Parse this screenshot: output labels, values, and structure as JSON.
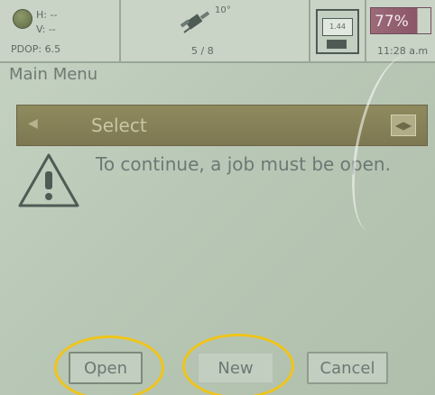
{
  "status": {
    "sat_h": "H: --",
    "sat_v": "V: --",
    "pdop": "PDOP: 6.5",
    "ant_degree": "10°",
    "ant_count": "5 / 8",
    "disk_label": "1.44",
    "battery_percent": "77%",
    "time": "11:28 a.m"
  },
  "menu": {
    "title": "Main Menu",
    "select_label": "Select",
    "message": "To continue, a job must be open."
  },
  "buttons": {
    "open": "Open",
    "new": "New",
    "cancel": "Cancel"
  },
  "icons": {
    "satellite": "satellite-status-icon",
    "antenna": "antenna-icon",
    "disk": "floppy-disk-icon",
    "battery": "battery-icon",
    "warning": "warning-icon",
    "select_arrow": "dropdown-arrow-icon",
    "select_btn": "select-toggle-icon"
  },
  "colors": {
    "highlight_ring": "#f0c419",
    "select_bar": "#8f8a5e",
    "screen": "#b9c8b6",
    "battery": "#9c6a78"
  }
}
